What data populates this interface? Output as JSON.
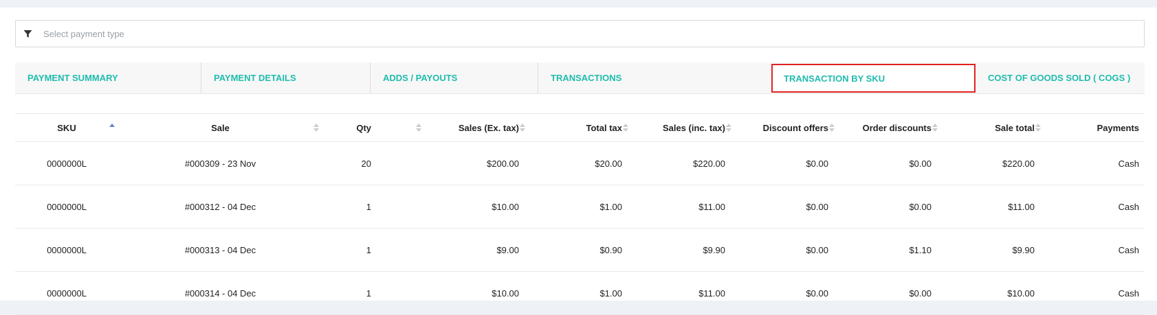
{
  "filter": {
    "placeholder": "Select payment type"
  },
  "tabs": [
    {
      "label": "PAYMENT SUMMARY"
    },
    {
      "label": "PAYMENT DETAILS"
    },
    {
      "label": "ADDS / PAYOUTS"
    },
    {
      "label": "TRANSACTIONS"
    },
    {
      "label": "TRANSACTION BY SKU"
    },
    {
      "label": "COST OF GOODS SOLD ( COGS )"
    }
  ],
  "active_tab": "TRANSACTION BY SKU",
  "colors": {
    "accent": "#1fbcae",
    "highlight": "#e32222",
    "sort_active": "#6b7fd7"
  },
  "table": {
    "columns": [
      "SKU",
      "Sale",
      "Qty",
      "Sales (Ex. tax)",
      "Total tax",
      "Sales (inc. tax)",
      "Discount offers",
      "Order discounts",
      "Sale total",
      "Payments"
    ],
    "rows": [
      [
        "0000000L",
        "#000309 - 23 Nov",
        "20",
        "$200.00",
        "$20.00",
        "$220.00",
        "$0.00",
        "$0.00",
        "$220.00",
        "Cash"
      ],
      [
        "0000000L",
        "#000312 - 04 Dec",
        "1",
        "$10.00",
        "$1.00",
        "$11.00",
        "$0.00",
        "$0.00",
        "$11.00",
        "Cash"
      ],
      [
        "0000000L",
        "#000313 - 04 Dec",
        "1",
        "$9.00",
        "$0.90",
        "$9.90",
        "$0.00",
        "$1.10",
        "$9.90",
        "Cash"
      ],
      [
        "0000000L",
        "#000314 - 04 Dec",
        "1",
        "$10.00",
        "$1.00",
        "$11.00",
        "$0.00",
        "$0.00",
        "$10.00",
        "Cash"
      ]
    ]
  }
}
